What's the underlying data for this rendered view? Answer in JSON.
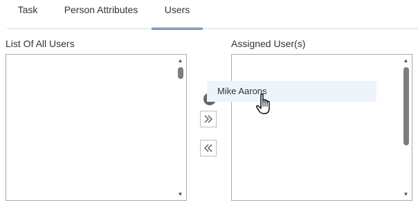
{
  "tabs": [
    {
      "label": "Task",
      "active": false
    },
    {
      "label": "Person Attributes",
      "active": false
    },
    {
      "label": "Users",
      "active": true
    }
  ],
  "all_users": {
    "label": "List Of All Users",
    "items": []
  },
  "assigned_users": {
    "label": "Assigned User(s)",
    "items": []
  },
  "move_buttons": {
    "assign_icon": "double-chevron-right-icon",
    "unassign_icon": "double-chevron-left-icon"
  },
  "drag_item": {
    "label": "Mike Aarons"
  },
  "cursor": "hand-pointer-icon",
  "colors": {
    "accent": "#2e67b8",
    "drag_highlight": "#eef4fc",
    "border": "#a9a9a9"
  }
}
